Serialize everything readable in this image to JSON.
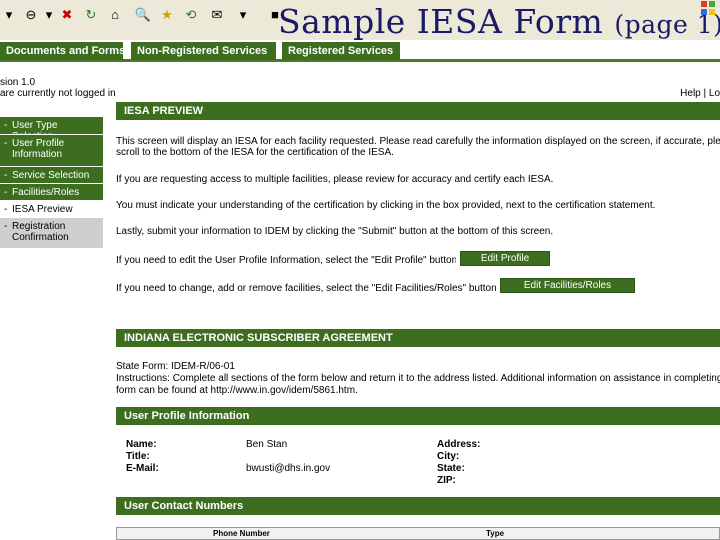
{
  "slide_title": "Sample IESA Form",
  "slide_subtitle": "(page 1)",
  "nav": {
    "tabs": [
      "Documents and Forms",
      "Non-Registered Services",
      "Registered Services"
    ]
  },
  "version": "sion 1.0",
  "login_message": "are currently not logged in",
  "help_link": "Help | Lo",
  "sidebar": {
    "items": [
      {
        "label": "User Type Selection"
      },
      {
        "label": "User Profile Information"
      },
      {
        "label": "Service Selection"
      },
      {
        "label": "Facilities/Roles"
      },
      {
        "label": "IESA Preview"
      },
      {
        "label": "Registration Confirmation"
      }
    ]
  },
  "preview": {
    "header": "IESA PREVIEW",
    "p1_line1": "This screen will display an IESA for each facility requested. Please read carefully the information displayed on the screen, if accurate, please",
    "p1_line2": "scroll to the bottom of the IESA for the certification of the IESA.",
    "p2": "If you are requesting access to multiple facilities, please review for accuracy and certify each IESA.",
    "p3": "You must indicate your understanding of the certification by clicking in the box provided, next to the certification statement.",
    "p4": "Lastly, submit your information to IDEM by clicking the \"Submit\" button at the bottom of this screen.",
    "edit_profile_text": "If you need to edit the User Profile Information, select the \"Edit Profile\" button",
    "edit_profile_btn": "Edit Profile",
    "edit_fac_text": "If you need to change, add or remove facilities, select the \"Edit Facilities/Roles\" button",
    "edit_fac_btn": "Edit Facilities/Roles"
  },
  "agreement": {
    "header": "INDIANA ELECTRONIC SUBSCRIBER AGREEMENT",
    "state_form": "State Form: IDEM-R/06-01",
    "instr_line1": "Instructions: Complete all sections of the form below and return it to the address listed. Additional information on assistance in completing the",
    "instr_line2": "form can be found at http://www.in.gov/idem/5861.htm."
  },
  "profile": {
    "header": "User Profile Information",
    "name_label": "Name:",
    "name_value": "Ben Stan",
    "title_label": "Title:",
    "email_label": "E-Mail:",
    "email_value": "bwusti@dhs.in.gov",
    "address_label": "Address:",
    "city_label": "City:",
    "state_label": "State:",
    "zip_label": "ZIP:"
  },
  "contacts": {
    "header": "User Contact Numbers",
    "col_phone": "Phone Number",
    "col_type": "Type"
  },
  "colors": {
    "accent_green": "#3d6e20",
    "title_navy": "#1a1a66"
  }
}
